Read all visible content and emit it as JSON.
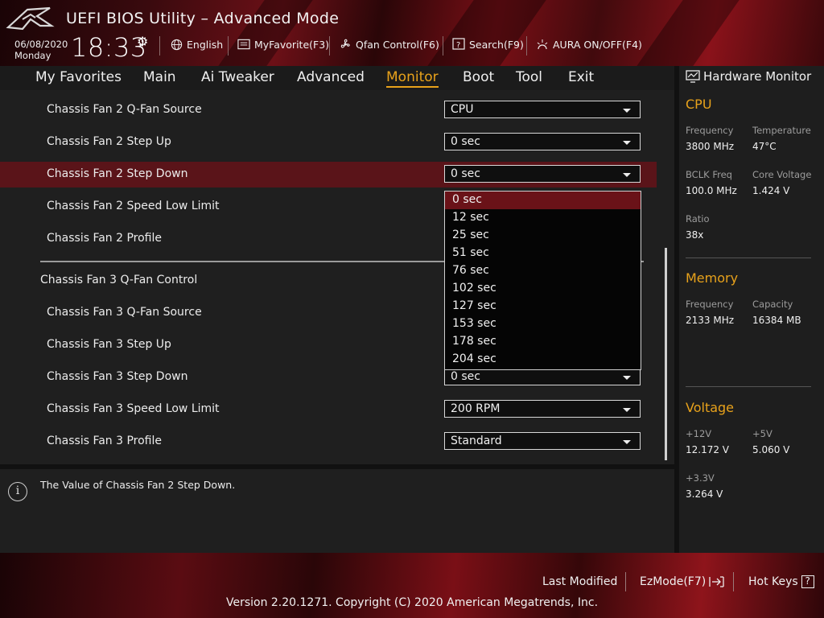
{
  "header": {
    "title": "UEFI BIOS Utility – Advanced Mode",
    "date": "06/08/2020",
    "day": "Monday",
    "time": "18:33",
    "tools": {
      "language": "English",
      "myfavorite": "MyFavorite(F3)",
      "qfan": "Qfan Control(F6)",
      "search": "Search(F9)",
      "aura": "AURA ON/OFF(F4)"
    }
  },
  "menu": {
    "tabs": [
      "My Favorites",
      "Main",
      "Ai Tweaker",
      "Advanced",
      "Monitor",
      "Boot",
      "Tool",
      "Exit"
    ],
    "active": "Monitor"
  },
  "settings": {
    "fan2_source": {
      "label": "Chassis Fan 2 Q-Fan Source",
      "value": "CPU"
    },
    "fan2_stepup": {
      "label": "Chassis Fan 2 Step Up",
      "value": "0 sec"
    },
    "fan2_stepdown": {
      "label": "Chassis Fan 2 Step Down",
      "value": "0 sec"
    },
    "fan2_low": {
      "label": "Chassis Fan 2 Speed Low Limit"
    },
    "fan2_profile": {
      "label": "Chassis Fan 2 Profile"
    },
    "fan3_control": {
      "label": "Chassis Fan 3 Q-Fan Control"
    },
    "fan3_source": {
      "label": "Chassis Fan 3 Q-Fan Source"
    },
    "fan3_stepup": {
      "label": "Chassis Fan 3 Step Up"
    },
    "fan3_stepdown": {
      "label": "Chassis Fan 3 Step Down",
      "value": "0 sec"
    },
    "fan3_low": {
      "label": "Chassis Fan 3 Speed Low Limit",
      "value": "200 RPM"
    },
    "fan3_profile": {
      "label": "Chassis Fan 3 Profile",
      "value": "Standard"
    }
  },
  "dropdown": {
    "options": [
      "0 sec",
      "12 sec",
      "25 sec",
      "51 sec",
      "76 sec",
      "102 sec",
      "127 sec",
      "153 sec",
      "178 sec",
      "204 sec"
    ],
    "highlighted": "0 sec"
  },
  "help": {
    "text": "The Value of Chassis Fan 2 Step Down."
  },
  "hardware_monitor": {
    "title": "Hardware Monitor",
    "cpu": {
      "section": "CPU",
      "frequency_label": "Frequency",
      "frequency": "3800 MHz",
      "temperature_label": "Temperature",
      "temperature": "47°C",
      "bclk_label": "BCLK Freq",
      "bclk": "100.0 MHz",
      "core_voltage_label": "Core Voltage",
      "core_voltage": "1.424 V",
      "ratio_label": "Ratio",
      "ratio": "38x"
    },
    "memory": {
      "section": "Memory",
      "frequency_label": "Frequency",
      "frequency": "2133 MHz",
      "capacity_label": "Capacity",
      "capacity": "16384 MB"
    },
    "voltage": {
      "section": "Voltage",
      "v12_label": "+12V",
      "v12": "12.172 V",
      "v5_label": "+5V",
      "v5": "5.060 V",
      "v33_label": "+3.3V",
      "v33": "3.264 V"
    }
  },
  "footer": {
    "last_modified": "Last Modified",
    "ezmode": "EzMode(F7)",
    "hotkeys": "Hot Keys",
    "hotkeys_icon_glyph": "?",
    "copyright": "Version 2.20.1271. Copyright (C) 2020 American Megatrends, Inc."
  },
  "colors": {
    "accent": "#e8a21b",
    "selection": "#5a1419",
    "brand_red": "#7a0f16"
  }
}
